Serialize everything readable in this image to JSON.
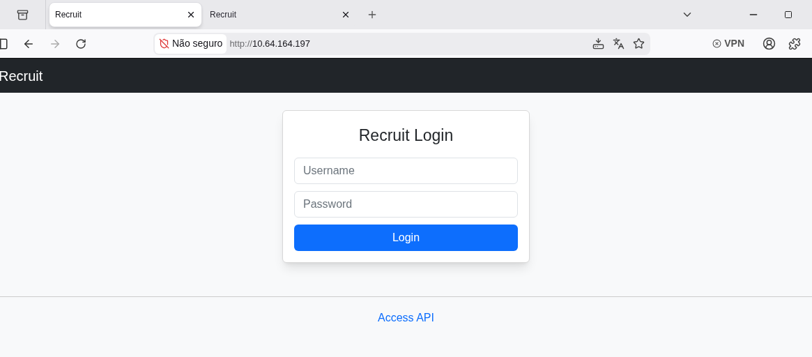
{
  "tabs": [
    {
      "title": "Recruit",
      "selected": true
    },
    {
      "title": "Recruit",
      "selected": false
    }
  ],
  "address_bar": {
    "security": "Não seguro",
    "scheme": "http://",
    "host": "10.64.164.197"
  },
  "vpn": {
    "label": "VPN"
  },
  "navbar": {
    "brand": "Recruit"
  },
  "login": {
    "title": "Recruit Login",
    "fields": [
      {
        "placeholder": "Username"
      },
      {
        "placeholder": "Password"
      }
    ],
    "button": "Login"
  },
  "footer": {
    "link": "Access API"
  }
}
